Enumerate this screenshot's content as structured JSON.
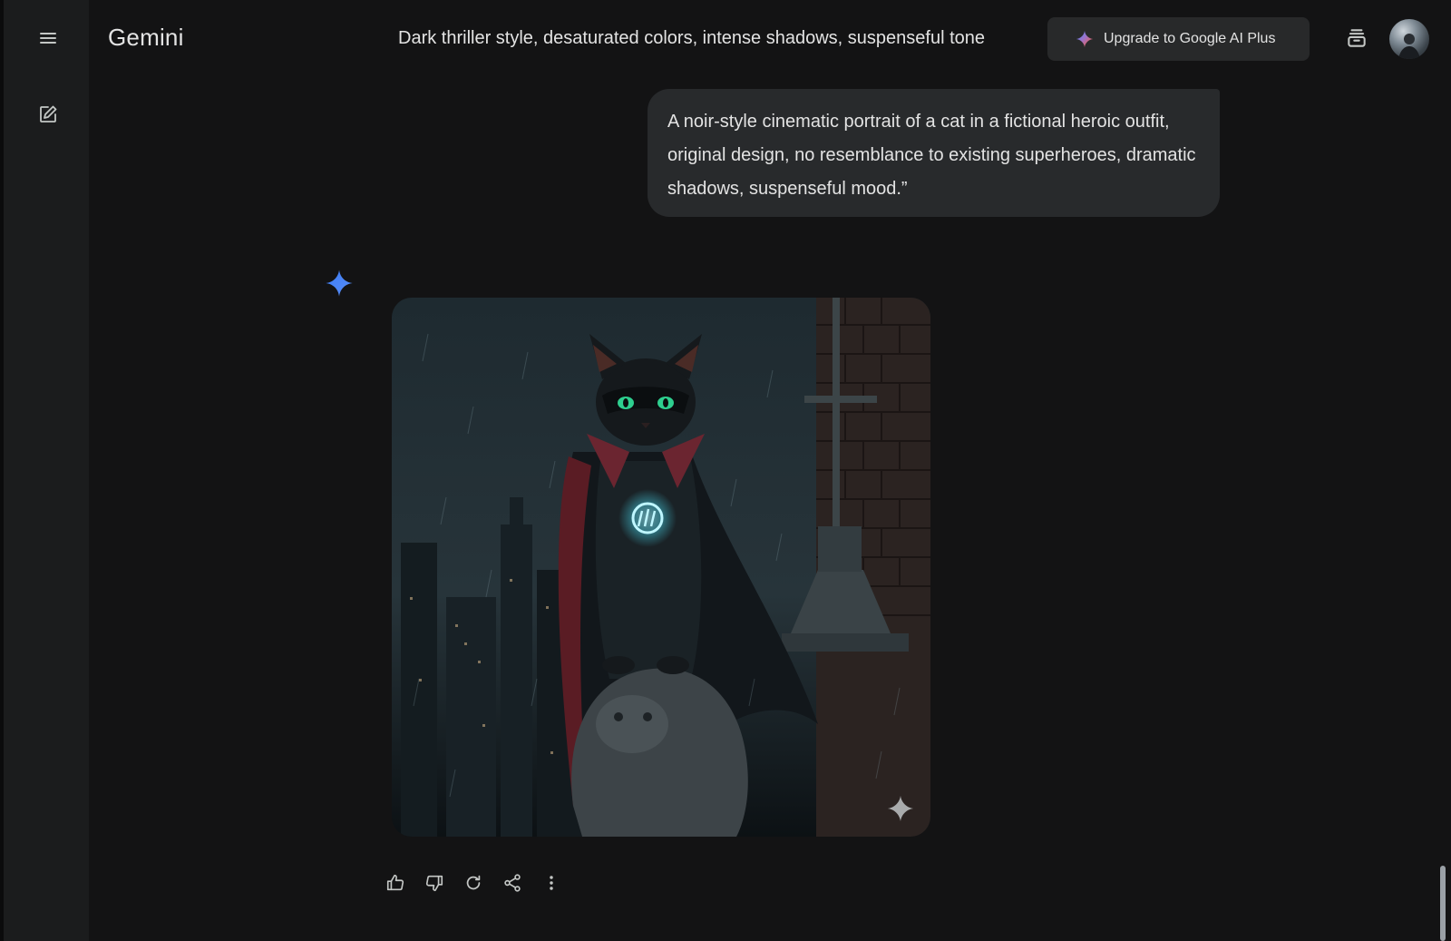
{
  "app": {
    "name": "Gemini"
  },
  "sidebar": {
    "menu_icon": "menu-icon",
    "new_chat_icon": "edit-icon"
  },
  "header": {
    "chat_title": "Dark thriller style, desaturated colors, intense shadows, suspenseful tone",
    "upgrade_label": "Upgrade to Google AI Plus",
    "upgrade_icon": "gemini-sparkle-icon",
    "temporary_chat_icon": "temporary-chat-icon",
    "avatar_icon": "avatar"
  },
  "conversation": {
    "user_message": "A noir-style cinematic portrait of a cat in a fictional heroic outfit, original design, no resemblance to existing superheroes, dramatic shadows, suspenseful mood.”",
    "response_icon": "gemini-sparkle-icon",
    "response_image_icon": "generated-image"
  },
  "actions": [
    {
      "name": "thumbs-up",
      "icon": "thumbs-up-icon"
    },
    {
      "name": "thumbs-down",
      "icon": "thumbs-down-icon"
    },
    {
      "name": "regenerate",
      "icon": "refresh-icon"
    },
    {
      "name": "share",
      "icon": "share-icon"
    },
    {
      "name": "more",
      "icon": "more-vert-icon"
    }
  ],
  "colors": {
    "background": "#131314",
    "sidebar": "#1b1c1d",
    "bubble": "#282a2c",
    "button": "#28292a",
    "text": "#e3e3e3",
    "gemini_blue": "#4285f4"
  }
}
